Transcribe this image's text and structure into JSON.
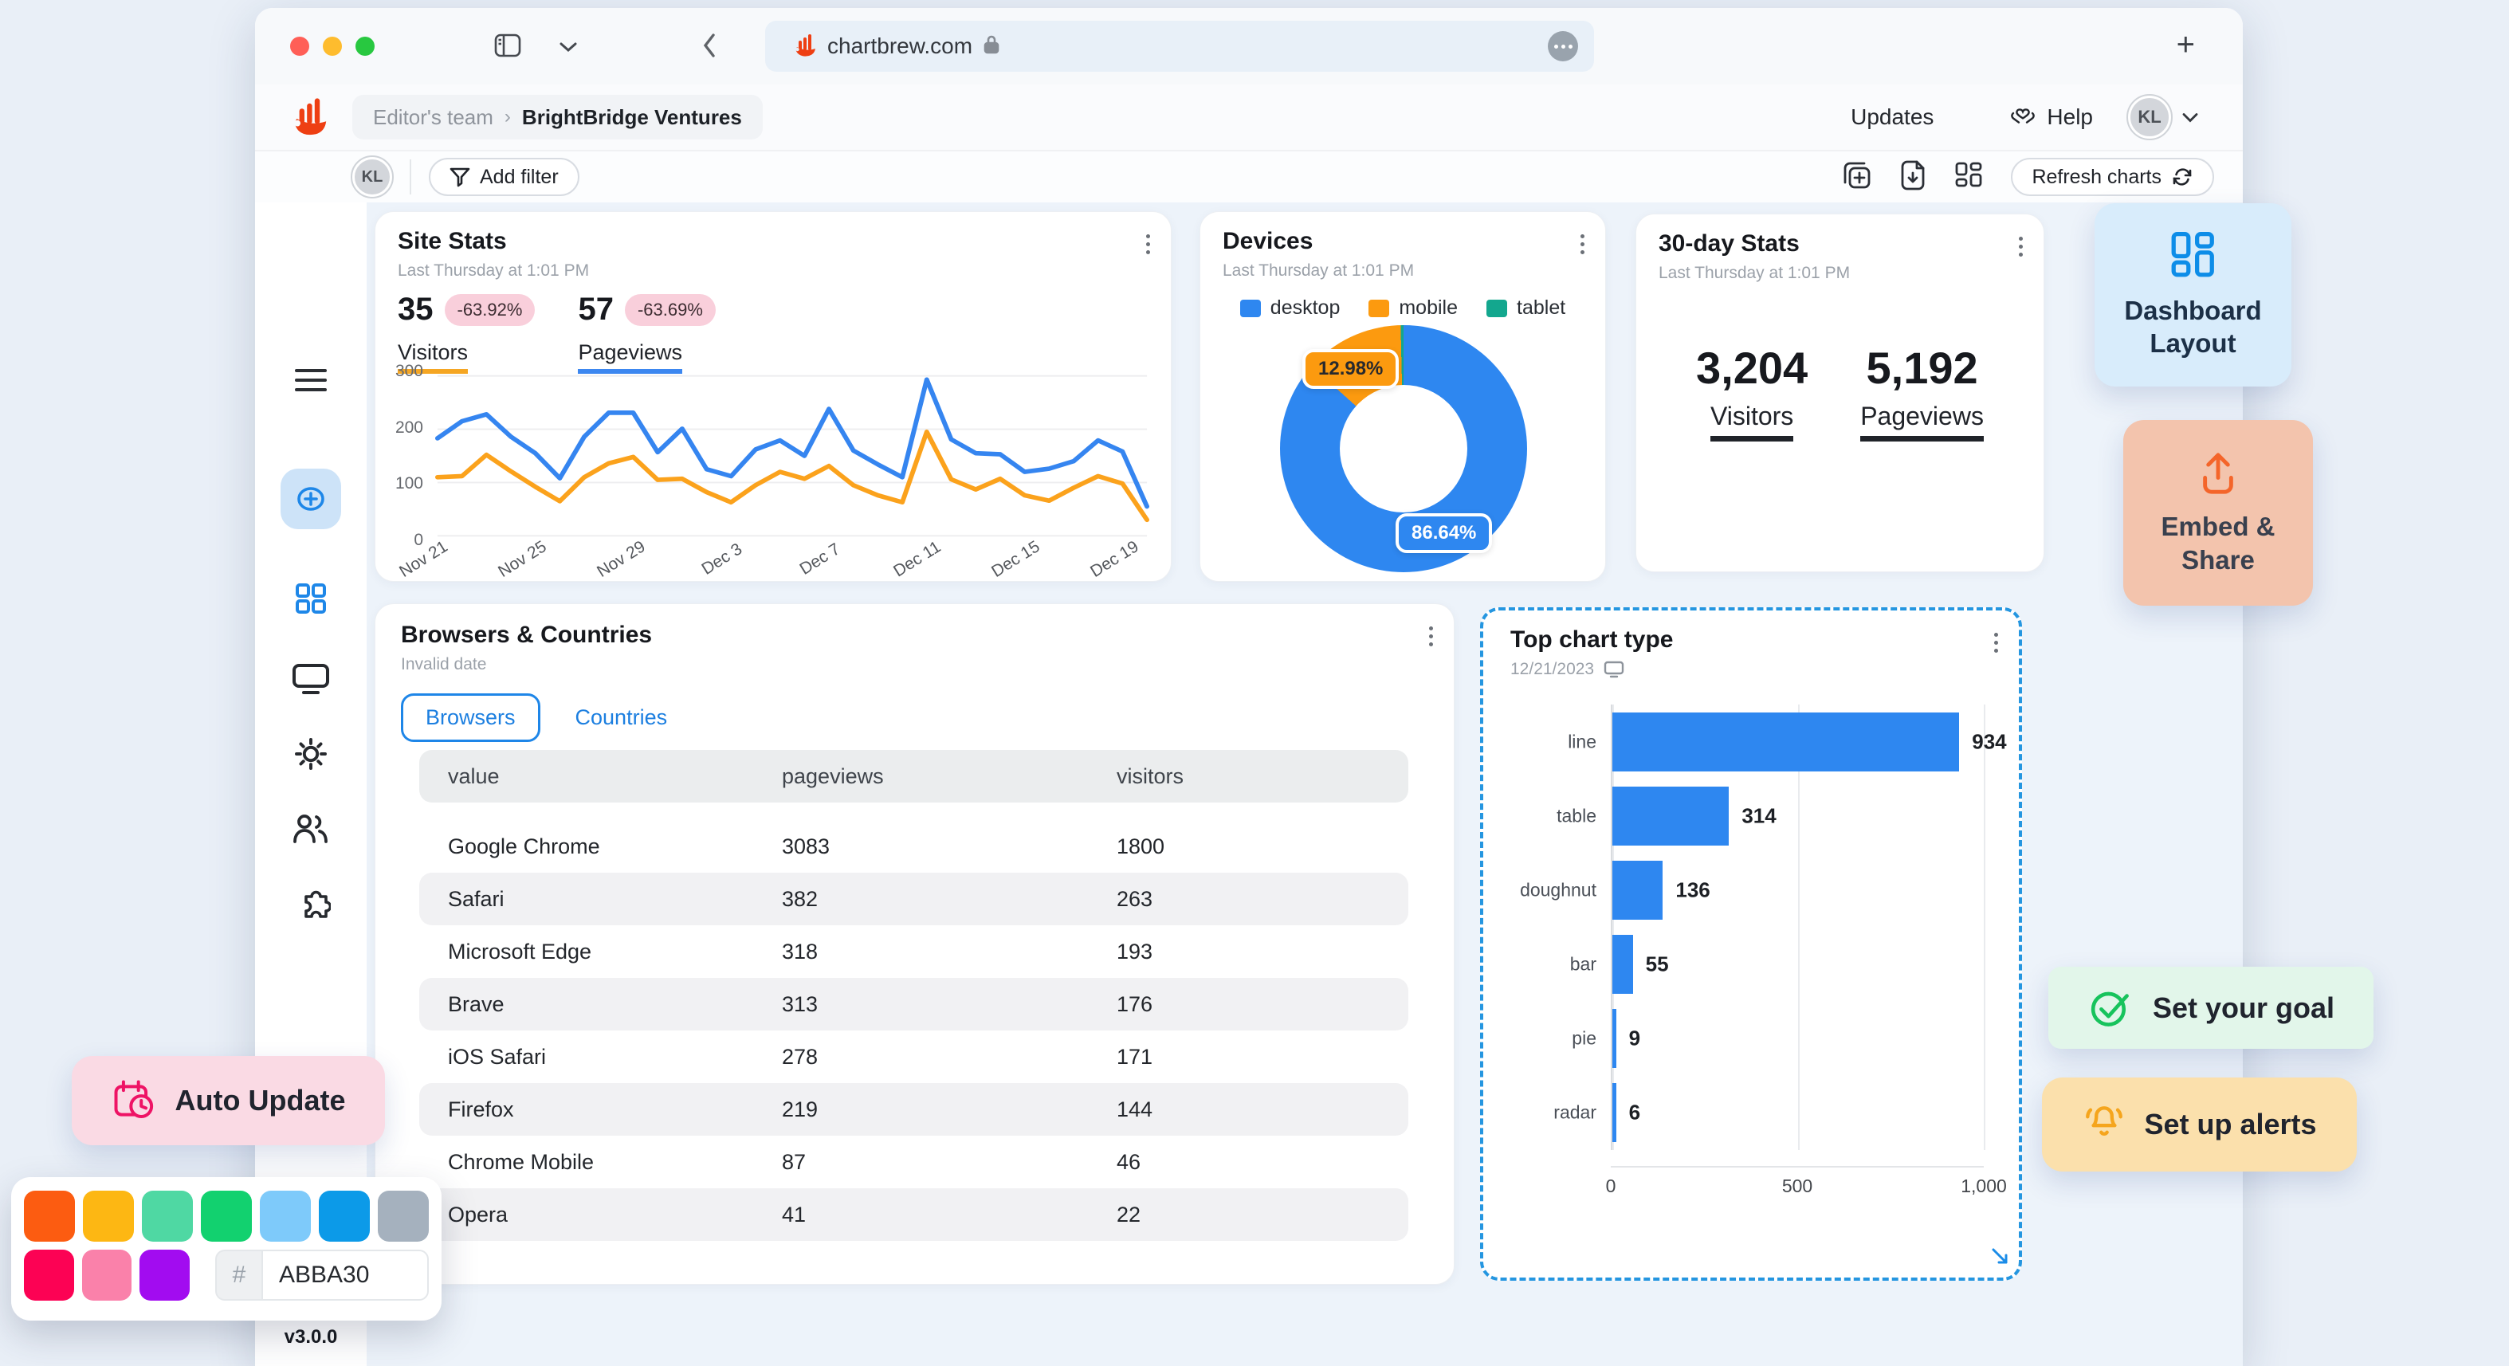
{
  "browser": {
    "url": "chartbrew.com",
    "new_tab_label": "+"
  },
  "header": {
    "breadcrumb": {
      "team": "Editor's team",
      "separator": "›",
      "project": "BrightBridge Ventures"
    },
    "updates_label": "Updates",
    "help_label": "Help",
    "avatar_initials": "KL"
  },
  "toolbar": {
    "avatar_initials": "KL",
    "add_filter_label": "Add filter",
    "refresh_label": "Refresh charts"
  },
  "sidebar": {
    "version": "v3.0.0"
  },
  "cards": {
    "site_stats": {
      "title": "Site Stats",
      "subtitle": "Last Thursday at 1:01 PM",
      "metrics": [
        {
          "value": "35",
          "change": "-63.92%",
          "label": "Visitors"
        },
        {
          "value": "57",
          "change": "-63.69%",
          "label": "Pageviews"
        }
      ]
    },
    "devices": {
      "title": "Devices",
      "subtitle": "Last Thursday at 1:01 PM"
    },
    "thirty_day": {
      "title": "30-day Stats",
      "subtitle": "Last Thursday at 1:01 PM",
      "metrics": [
        {
          "value": "3,204",
          "label": "Visitors"
        },
        {
          "value": "5,192",
          "label": "Pageviews"
        }
      ]
    },
    "browsers": {
      "title": "Browsers & Countries",
      "subtitle": "Invalid date",
      "tabs": [
        "Browsers",
        "Countries"
      ],
      "active_tab": "Browsers",
      "table": {
        "headers": [
          "value",
          "pageviews",
          "visitors"
        ],
        "rows": [
          [
            "Google Chrome",
            "3083",
            "1800"
          ],
          [
            "Safari",
            "382",
            "263"
          ],
          [
            "Microsoft Edge",
            "318",
            "193"
          ],
          [
            "Brave",
            "313",
            "176"
          ],
          [
            "iOS Safari",
            "278",
            "171"
          ],
          [
            "Firefox",
            "219",
            "144"
          ],
          [
            "Chrome Mobile",
            "87",
            "46"
          ],
          [
            "Opera",
            "41",
            "22"
          ]
        ]
      }
    },
    "top_chart": {
      "title": "Top chart type",
      "subtitle": "12/21/2023"
    }
  },
  "chart_data": [
    {
      "name": "site_stats_timeseries",
      "type": "line",
      "title": "Site Stats",
      "ylim": [
        0,
        300
      ],
      "y_ticks": [
        "300",
        "200",
        "100",
        "0"
      ],
      "x_ticks": [
        "Nov 21",
        "Nov 25",
        "Nov 29",
        "Dec 3",
        "Dec 7",
        "Dec 11",
        "Dec 15",
        "Dec 19"
      ],
      "x_tick_indexes": [
        0,
        4,
        8,
        12,
        16,
        20,
        24,
        28
      ],
      "grid": true,
      "series": [
        {
          "name": "Pageviews",
          "color": "#3585f0",
          "values": [
            183,
            215,
            228,
            186,
            155,
            108,
            186,
            231,
            231,
            157,
            201,
            125,
            112,
            162,
            179,
            150,
            238,
            160,
            134,
            110,
            293,
            181,
            155,
            153,
            120,
            126,
            140,
            179,
            158,
            55
          ]
        },
        {
          "name": "Visitors",
          "color": "#fba21c",
          "values": [
            110,
            112,
            152,
            121,
            92,
            65,
            110,
            136,
            148,
            105,
            107,
            82,
            63,
            95,
            120,
            107,
            131,
            95,
            76,
            63,
            195,
            106,
            87,
            107,
            76,
            66,
            90,
            112,
            98,
            30
          ]
        }
      ]
    },
    {
      "name": "devices_doughnut",
      "type": "pie",
      "title": "Devices",
      "labels": [
        "desktop",
        "mobile",
        "tablet"
      ],
      "values": [
        86.64,
        12.98,
        0.38
      ],
      "colors": [
        "#2e87f0",
        "#fc9a0f",
        "#13a78e"
      ],
      "badges": {
        "desktop": "86.64%",
        "mobile": "12.98%"
      },
      "legend_position": "top"
    },
    {
      "name": "top_chart_type",
      "type": "bar",
      "orientation": "horizontal",
      "title": "Top chart type",
      "categories": [
        "line",
        "table",
        "doughnut",
        "bar",
        "pie",
        "radar"
      ],
      "values": [
        934,
        314,
        136,
        55,
        9,
        6
      ],
      "xlim": [
        0,
        1000
      ],
      "x_ticks": [
        {
          "label": "0",
          "pct": 0
        },
        {
          "label": "500",
          "pct": 50
        },
        {
          "label": "1,000",
          "pct": 100
        }
      ],
      "bar_color": "#2e87f0"
    }
  ],
  "floating": {
    "dashboard_layout": "Dashboard Layout",
    "embed_share": "Embed & Share",
    "set_goal": "Set your goal",
    "set_alerts": "Set up alerts",
    "auto_update": "Auto Update"
  },
  "palette": {
    "row1": [
      "#fc5c11",
      "#fdb713",
      "#4fd8a3",
      "#12d16f",
      "#7ecafa",
      "#0c9ae8",
      "#a5b1be"
    ],
    "row2": [
      "#fc0254",
      "#fa81aa",
      "#a20cf0"
    ],
    "hex_prefix": "#",
    "hex_value": "ABBA30"
  },
  "colors": {
    "accent_blue": "#2e87f0",
    "accent_orange": "#fba21c",
    "brand_orange": "#ee3f13"
  }
}
